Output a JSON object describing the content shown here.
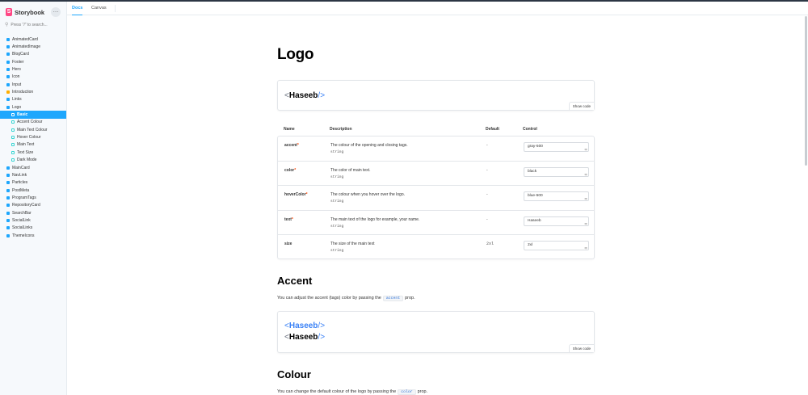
{
  "app": {
    "name": "Storybook",
    "logo_letter": "S",
    "menu_label": "…"
  },
  "search": {
    "placeholder": "Press \"/\" to search..."
  },
  "tabs": [
    {
      "label": "Docs",
      "active": true
    },
    {
      "label": "Canvas",
      "active": false
    }
  ],
  "sidebar": {
    "items": [
      {
        "label": "AnimatedCard",
        "kind": "component",
        "level": 0
      },
      {
        "label": "AnimatedImage",
        "kind": "component",
        "level": 0
      },
      {
        "label": "BlogCard",
        "kind": "component",
        "level": 0
      },
      {
        "label": "Footer",
        "kind": "component",
        "level": 0
      },
      {
        "label": "Hero",
        "kind": "component",
        "level": 0
      },
      {
        "label": "Icon",
        "kind": "component",
        "level": 0
      },
      {
        "label": "Input",
        "kind": "component",
        "level": 0
      },
      {
        "label": "Introduction",
        "kind": "doc",
        "level": 0
      },
      {
        "label": "Links",
        "kind": "component",
        "level": 0
      },
      {
        "label": "Logo",
        "kind": "component",
        "level": 0
      },
      {
        "label": "Basic",
        "kind": "story",
        "level": 1,
        "selected": true
      },
      {
        "label": "Accent Colour",
        "kind": "story",
        "level": 1
      },
      {
        "label": "Main Text Colour",
        "kind": "story",
        "level": 1
      },
      {
        "label": "Hover Colour",
        "kind": "story",
        "level": 1
      },
      {
        "label": "Main Text",
        "kind": "story",
        "level": 1
      },
      {
        "label": "Text Size",
        "kind": "story",
        "level": 1
      },
      {
        "label": "Dark Mode",
        "kind": "story",
        "level": 1
      },
      {
        "label": "MainCard",
        "kind": "component",
        "level": 0
      },
      {
        "label": "NavLink",
        "kind": "component",
        "level": 0
      },
      {
        "label": "Particles",
        "kind": "component",
        "level": 0
      },
      {
        "label": "PostMeta",
        "kind": "component",
        "level": 0
      },
      {
        "label": "ProgramTags",
        "kind": "component",
        "level": 0
      },
      {
        "label": "RepositoryCard",
        "kind": "component",
        "level": 0
      },
      {
        "label": "SearchBar",
        "kind": "component",
        "level": 0
      },
      {
        "label": "SocialLink",
        "kind": "component",
        "level": 0
      },
      {
        "label": "SocialLinks",
        "kind": "component",
        "level": 0
      },
      {
        "label": "ThemeIcons",
        "kind": "component",
        "level": 0
      }
    ]
  },
  "docs": {
    "title": "Logo",
    "preview": {
      "open": "<",
      "text": "Haseeb",
      "close": "/>",
      "show_code": "Show code"
    },
    "args_table": {
      "headers": {
        "name": "Name",
        "description": "Description",
        "default": "Default",
        "control": "Control"
      },
      "rows": [
        {
          "name": "accent",
          "required": "*",
          "description": "The colour of the opening and closing tags.",
          "type": "string",
          "default": "-",
          "control": "gray-500"
        },
        {
          "name": "color",
          "required": "*",
          "description": "The color of main text.",
          "type": "string",
          "default": "-",
          "control": "black"
        },
        {
          "name": "hoverColor",
          "required": "*",
          "description": "The colour when you hover over the logo.",
          "type": "string",
          "default": "-",
          "control": "blue-500"
        },
        {
          "name": "text",
          "required": "*",
          "description": "The main text of the logo for example, your name.",
          "type": "string",
          "default": "-",
          "control": "Haseeb"
        },
        {
          "name": "size",
          "required": "",
          "description": "The size of the main text",
          "type": "string",
          "default": "2xl",
          "control": "2xl"
        }
      ]
    },
    "accent": {
      "heading": "Accent",
      "para_before": "You can adjust the accent (tags) color by passing the",
      "code": "accent",
      "para_after": "prop.",
      "preview": {
        "open": "<",
        "text": "Haseeb",
        "close": "/>",
        "show_code": "Show code"
      }
    },
    "colour": {
      "heading": "Colour",
      "para_before": "You can change the default colour of the logo by passing the",
      "code": "color",
      "para_after": "prop."
    }
  },
  "colors": {
    "accent": "#1ea7fd",
    "brand": "#ff4785",
    "preview_blue": "#3b82f6",
    "required": "#ff4400"
  }
}
